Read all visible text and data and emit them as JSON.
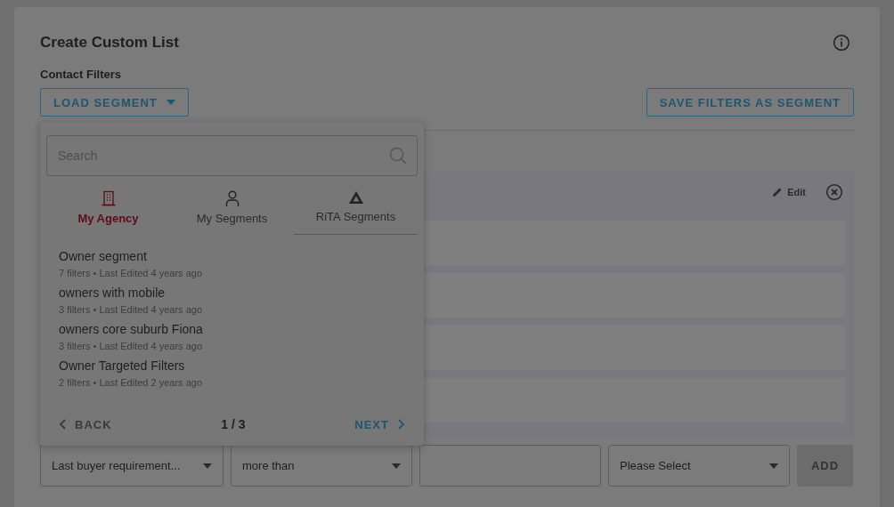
{
  "title": "Create Custom List",
  "section_label": "Contact Filters",
  "load_button": {
    "label": "LOAD SEGMENT"
  },
  "save_button": {
    "label": "SAVE FILTERS AS SEGMENT"
  },
  "filter_group": {
    "edit_label": "Edit"
  },
  "add_row": {
    "field_select": "Last buyer requirement...",
    "operator_select": "more than",
    "unit_select": "Please Select",
    "add_button": "ADD",
    "add_disabled": true
  },
  "dropdown": {
    "search_placeholder": "Search",
    "tabs": [
      {
        "label": "My Agency",
        "selected": true,
        "underlined": false
      },
      {
        "label": "My Segments",
        "selected": false,
        "underlined": false
      },
      {
        "label": "RiTA Segments",
        "selected": false,
        "underlined": true
      }
    ],
    "segments": [
      {
        "name": "Owner segment",
        "meta": "7 filters • Last Edited 4 years ago"
      },
      {
        "name": "owners with mobile",
        "meta": "3 filters • Last Edited 4 years ago"
      },
      {
        "name": "owners core suburb Fiona",
        "meta": "3 filters • Last Edited 4 years ago"
      },
      {
        "name": "Owner Targeted Filters",
        "meta": "2 filters • Last Edited 2 years ago"
      }
    ],
    "back_label": "BACK",
    "back_disabled": true,
    "page": "1 / 3",
    "next_label": "NEXT",
    "next_disabled": false
  }
}
